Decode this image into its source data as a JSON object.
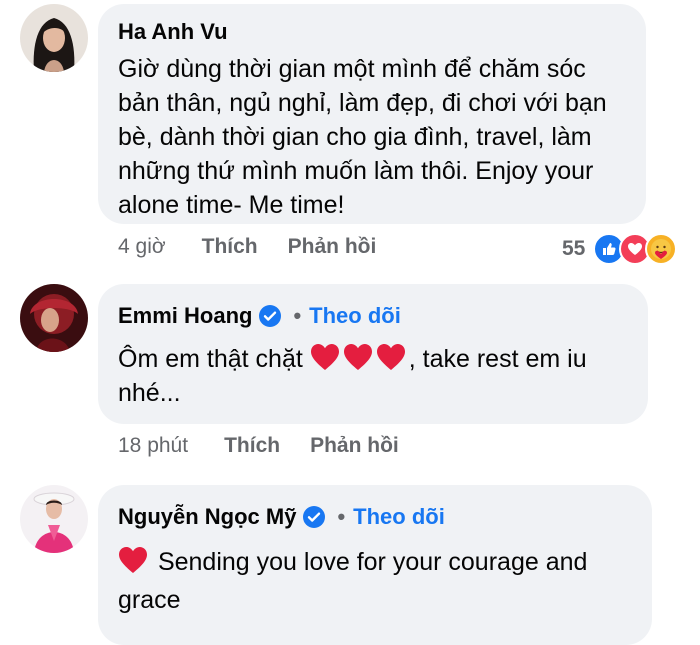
{
  "comments": [
    {
      "author": "Ha Anh Vu",
      "text": "Giờ dùng thời gian một mình để chăm sóc bản thân, ngủ nghỉ, làm đẹp, đi chơi với bạn bè, dành thời gian cho gia đình, travel, làm những thứ mình muốn làm thôi. Enjoy your alone time- Me time!",
      "time": "4 giờ",
      "like_label": "Thích",
      "reply_label": "Phản hồi",
      "reaction_count": "55",
      "reaction_icons": [
        "like-icon",
        "love-icon",
        "care-icon"
      ]
    },
    {
      "author": "Emmi Hoang",
      "verified": true,
      "separator": "•",
      "follow_label": "Theo dõi",
      "text_before": "Ôm em thật chặt",
      "emoji": [
        "heart-icon",
        "heart-icon",
        "heart-icon"
      ],
      "text_after": ", take rest em iu nhé...",
      "time": "18 phút",
      "like_label": "Thích",
      "reply_label": "Phản hồi"
    },
    {
      "author": "Nguyễn Ngọc Mỹ",
      "verified": true,
      "separator": "•",
      "follow_label": "Theo dõi",
      "emoji": [
        "heart-icon"
      ],
      "text": "Sending you love for your courage and grace"
    }
  ],
  "colors": {
    "bubble": "#f0f2f5",
    "link_blue": "#1877f2",
    "meta_gray": "#65676b",
    "heart_red": "#e41e3f"
  }
}
